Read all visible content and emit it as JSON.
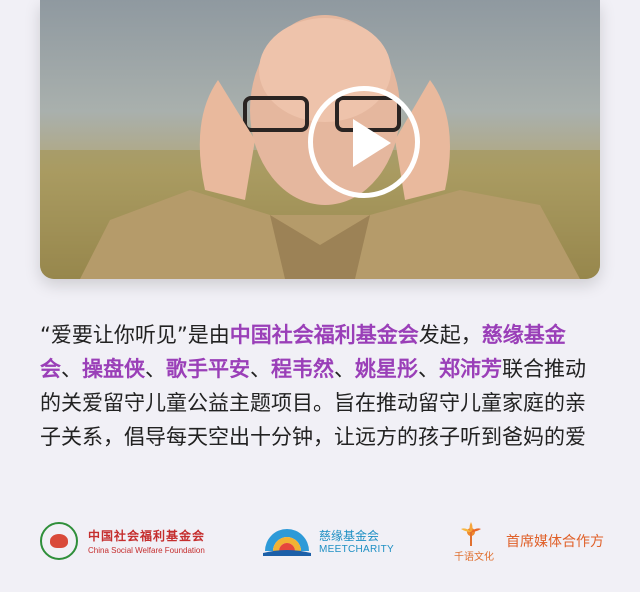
{
  "video": {
    "thumbnail": "bald-man-glasses-hands-by-ears-field",
    "play_icon": "play-circle-icon"
  },
  "description": {
    "seg1": "“爱要让你听见”是由",
    "seg2": "中国社会福利基金会",
    "seg3": "发起，",
    "seg4": "慈缘基金会",
    "seg5": "、",
    "seg6": "操盘侠",
    "seg7": "、",
    "seg8": "歌手平安",
    "seg9": "、",
    "seg10": "程韦然",
    "seg11": "、",
    "seg12": "姚星彤",
    "seg13": "、",
    "seg14": "郑沛芳",
    "seg15": "联合推动的关爱留守儿童公益主题项目。旨在推动留守儿童家庭的亲子关系，倡导每天空出十分钟，让远方的孩子听到爸妈的爱"
  },
  "logos": {
    "csw_cn": "中国社会福利基金会",
    "csw_en": "China Social Welfare Foundation",
    "cyj_cn": "慈缘基金会",
    "cyj_en": "MEETCHARITY",
    "qianyu": "千语文化",
    "media_partner": "首席媒体合作方"
  },
  "colors": {
    "highlight": "#9a3fb8",
    "background": "#f1f0f6"
  }
}
